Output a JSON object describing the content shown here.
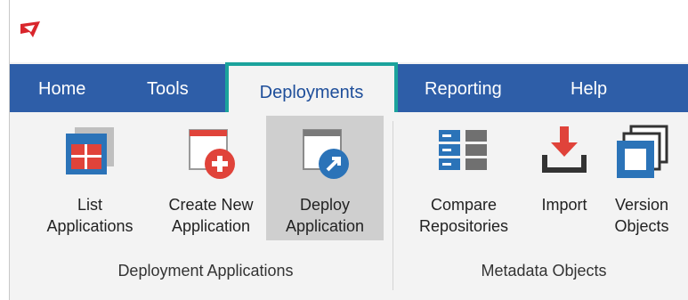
{
  "colors": {
    "menu_bar": "#2e5ea8",
    "active_tab_outline": "#1ba39c",
    "ribbon_bg": "#f3f3f3",
    "selected_command": "#cfcfcf",
    "icon_red": "#e0433a",
    "icon_blue": "#2b73b8"
  },
  "menu": {
    "tabs": [
      "Home",
      "Tools",
      "Deployments",
      "Reporting",
      "Help"
    ],
    "active_tab": "Deployments"
  },
  "ribbon": {
    "groups": [
      {
        "label": "Deployment Applications",
        "commands": [
          {
            "line1": "List",
            "line2": "Applications",
            "icon": "list-applications-icon"
          },
          {
            "line1": "Create New",
            "line2": "Application",
            "icon": "create-application-icon"
          },
          {
            "line1": "Deploy",
            "line2": "Application",
            "icon": "deploy-application-icon",
            "selected": true
          }
        ]
      },
      {
        "label": "Metadata Objects",
        "commands": [
          {
            "line1": "Compare",
            "line2": "Repositories",
            "icon": "compare-repositories-icon"
          },
          {
            "line1": "Import",
            "line2": "",
            "icon": "import-icon"
          },
          {
            "line1": "Version",
            "line2": "Objects",
            "icon": "version-objects-icon"
          }
        ]
      }
    ]
  }
}
